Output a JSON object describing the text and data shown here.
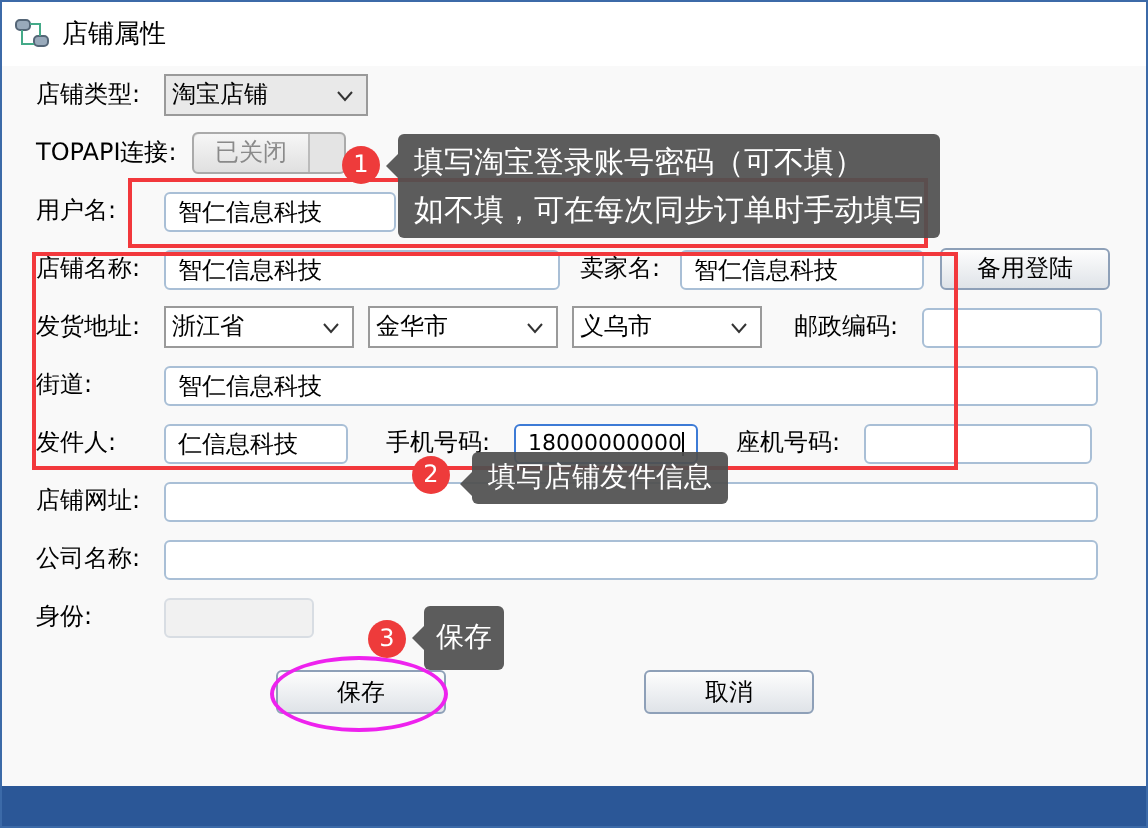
{
  "window": {
    "title": "店铺属性"
  },
  "form": {
    "rows": [
      {
        "items": [
          {
            "kind": "label",
            "text": "店铺类型:"
          },
          {
            "kind": "select",
            "value": "淘宝店铺"
          }
        ]
      },
      {
        "items": [
          {
            "kind": "label",
            "text": "TOPAPI连接:"
          },
          {
            "kind": "toggle",
            "text": "已关闭",
            "on": false
          }
        ]
      },
      {
        "items": [
          {
            "kind": "label",
            "text": "用户名:"
          },
          {
            "kind": "input",
            "value": "智仁信息科技"
          }
        ]
      },
      {
        "items": [
          {
            "kind": "label",
            "text": "店铺名称:"
          },
          {
            "kind": "input",
            "value": "智仁信息科技"
          },
          {
            "kind": "label",
            "text": "卖家名:"
          },
          {
            "kind": "input",
            "value": "智仁信息科技"
          },
          {
            "kind": "button",
            "text": "备用登陆"
          }
        ]
      },
      {
        "items": [
          {
            "kind": "label",
            "text": "发货地址:"
          },
          {
            "kind": "select",
            "value": "浙江省"
          },
          {
            "kind": "select",
            "value": "金华市"
          },
          {
            "kind": "select",
            "value": "义乌市"
          },
          {
            "kind": "label",
            "text": "邮政编码:"
          },
          {
            "kind": "input",
            "value": ""
          }
        ]
      },
      {
        "items": [
          {
            "kind": "label",
            "text": "街道:"
          },
          {
            "kind": "input",
            "value": "智仁信息科技"
          }
        ]
      },
      {
        "items": [
          {
            "kind": "label",
            "text": "发件人:"
          },
          {
            "kind": "input",
            "value": "仁信息科技"
          },
          {
            "kind": "label",
            "text": "手机号码:"
          },
          {
            "kind": "input",
            "value": "18000000000",
            "focused": true
          },
          {
            "kind": "label",
            "text": "座机号码:"
          },
          {
            "kind": "input",
            "value": ""
          }
        ]
      },
      {
        "items": [
          {
            "kind": "label",
            "text": "店铺网址:"
          },
          {
            "kind": "input",
            "value": ""
          }
        ]
      },
      {
        "items": [
          {
            "kind": "label",
            "text": "公司名称:"
          },
          {
            "kind": "input",
            "value": ""
          }
        ]
      },
      {
        "items": [
          {
            "kind": "label",
            "text": "身份:"
          },
          {
            "kind": "input",
            "value": "",
            "disabled": true
          }
        ]
      }
    ]
  },
  "buttons": [
    "保存",
    "取消"
  ],
  "annotations": [
    {
      "number": "1",
      "lines": [
        "填写淘宝登录账号密码（可不填）",
        "如不填，可在每次同步订单时手动填写"
      ]
    },
    {
      "number": "2",
      "lines": [
        "填写店铺发件信息"
      ]
    },
    {
      "number": "3",
      "lines": [
        "保存"
      ]
    }
  ]
}
